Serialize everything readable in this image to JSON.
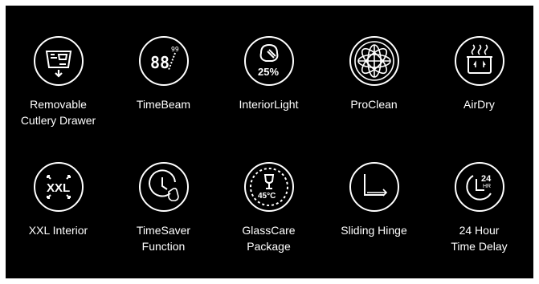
{
  "colors": {
    "background": "#000000",
    "frame": "#ffffff",
    "foreground": "#ffffff"
  },
  "features": [
    {
      "label": "Removable\nCutlery Drawer",
      "icon": "cutlery-drawer-icon"
    },
    {
      "label": "TimeBeam",
      "icon": "timebeam-icon",
      "icon_text": "88",
      "icon_small_text": "99"
    },
    {
      "label": "InteriorLight",
      "icon": "interior-light-icon",
      "icon_text": "25%"
    },
    {
      "label": "ProClean",
      "icon": "proclean-icon"
    },
    {
      "label": "AirDry",
      "icon": "airdry-icon"
    },
    {
      "label": "XXL Interior",
      "icon": "xxl-interior-icon",
      "icon_text": "XXL"
    },
    {
      "label": "TimeSaver\nFunction",
      "icon": "timesaver-icon"
    },
    {
      "label": "GlassCare\nPackage",
      "icon": "glasscare-icon",
      "icon_text": "45°C"
    },
    {
      "label": "Sliding Hinge",
      "icon": "sliding-hinge-icon"
    },
    {
      "label": "24 Hour\nTime Delay",
      "icon": "time-delay-icon",
      "icon_text": "24",
      "icon_small_text": "HR"
    }
  ]
}
